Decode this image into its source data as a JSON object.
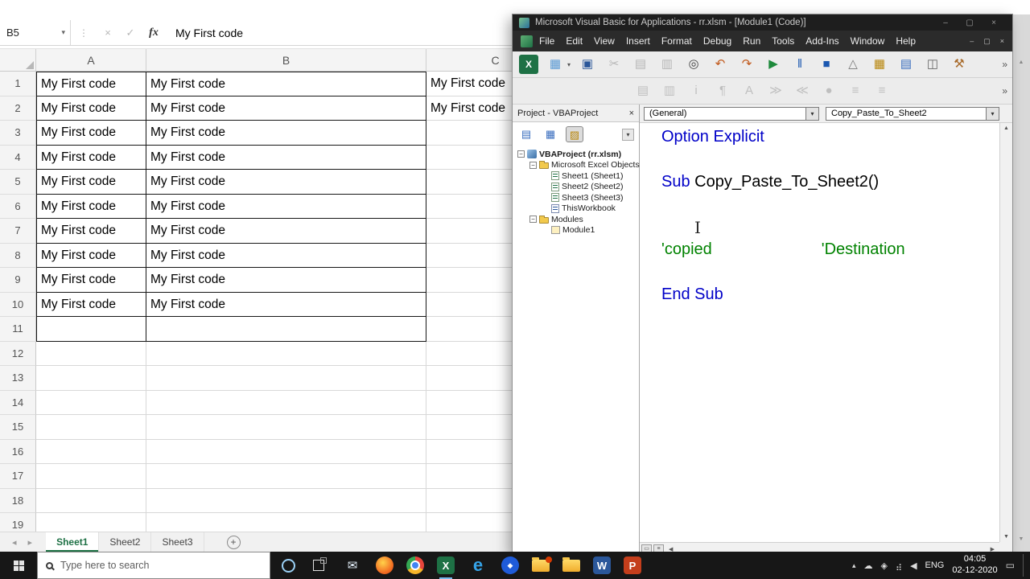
{
  "colors": {
    "excel_green": "#1e7145",
    "keyword_blue": "#0000C8",
    "comment_green": "#008200",
    "taskbar_dark": "#171717"
  },
  "excel": {
    "name_box": "B5",
    "formula_bar_value": "My First code",
    "fx_label": "fx",
    "cancel_glyph": "×",
    "enter_glyph": "✓",
    "columns": [
      "A",
      "B",
      "C"
    ],
    "row_labels": [
      "1",
      "2",
      "3",
      "4",
      "5",
      "6",
      "7",
      "8",
      "9",
      "10",
      "11",
      "12",
      "13",
      "14",
      "15",
      "16",
      "17",
      "18",
      "19"
    ],
    "cell_value": "My First code",
    "filled": {
      "a_b_rows": 10,
      "bordered_rows": 11,
      "c_rows": 2
    },
    "sheet_tabs": [
      {
        "label": "Sheet1",
        "active": true
      },
      {
        "label": "Sheet2",
        "active": false
      },
      {
        "label": "Sheet3",
        "active": false
      }
    ],
    "new_sheet_glyph": "+"
  },
  "vba": {
    "title": "Microsoft Visual Basic for Applications - rr.xlsm - [Module1 (Code)]",
    "window_controls": [
      "–",
      "▢",
      "×"
    ],
    "menus": [
      "File",
      "Edit",
      "View",
      "Insert",
      "Format",
      "Debug",
      "Run",
      "Tools",
      "Add-Ins",
      "Window",
      "Help"
    ],
    "toolbar_main": [
      {
        "name": "view-excel-icon",
        "glyph": "X",
        "bg": "#1e7145"
      },
      {
        "name": "insert-userform-icon",
        "glyph": "▦",
        "color": "#5b9bd5",
        "caret": true
      },
      {
        "name": "save-icon",
        "glyph": "▣",
        "color": "#2b579a"
      },
      {
        "name": "cut-icon",
        "glyph": "✂",
        "color": "#777",
        "dim": true
      },
      {
        "name": "copy-icon",
        "glyph": "▤",
        "color": "#777",
        "dim": true
      },
      {
        "name": "paste-icon",
        "glyph": "▥",
        "color": "#777",
        "dim": true
      },
      {
        "name": "find-icon",
        "glyph": "◎",
        "color": "#444"
      },
      {
        "name": "undo-icon",
        "glyph": "↶",
        "color": "#c25b1e"
      },
      {
        "name": "redo-icon",
        "glyph": "↷",
        "color": "#c25b1e"
      },
      {
        "name": "run-icon",
        "glyph": "▶",
        "color": "#1e8a3c"
      },
      {
        "name": "break-icon",
        "glyph": "‖",
        "color": "#1a57b0"
      },
      {
        "name": "reset-icon",
        "glyph": "■",
        "color": "#1a57b0"
      },
      {
        "name": "design-mode-icon",
        "glyph": "△",
        "color": "#777"
      },
      {
        "name": "project-explorer-icon",
        "glyph": "▦",
        "color": "#b8860b"
      },
      {
        "name": "properties-window-icon",
        "glyph": "▤",
        "color": "#3a6ebf"
      },
      {
        "name": "object-browser-icon",
        "glyph": "◫",
        "color": "#666"
      },
      {
        "name": "toolbox-icon",
        "glyph": "⚒",
        "color": "#a86a2a"
      }
    ],
    "toolbar_overflow_glyph": "»",
    "toolbar_edit": [
      {
        "name": "list-properties-icon",
        "glyph": "▤",
        "dim": true
      },
      {
        "name": "list-constants-icon",
        "glyph": "▥",
        "dim": true
      },
      {
        "name": "quick-info-icon",
        "glyph": "i",
        "dim": true
      },
      {
        "name": "parameter-info-icon",
        "glyph": "¶",
        "dim": true
      },
      {
        "name": "complete-word-icon",
        "glyph": "A",
        "dim": true
      },
      {
        "name": "indent-icon",
        "glyph": "≫",
        "dim": true
      },
      {
        "name": "outdent-icon",
        "glyph": "≪",
        "dim": true
      },
      {
        "name": "toggle-breakpoint-icon",
        "glyph": "●",
        "dim": true
      },
      {
        "name": "comment-block-icon",
        "glyph": "≡",
        "dim": true
      },
      {
        "name": "uncomment-block-icon",
        "glyph": "≡",
        "dim": true
      }
    ],
    "project": {
      "header": "Project - VBAProject",
      "close_glyph": "×",
      "toolbar": [
        {
          "name": "view-code-icon",
          "glyph": "▤",
          "color": "#3a6ebf"
        },
        {
          "name": "view-object-icon",
          "glyph": "▦",
          "color": "#3a6ebf"
        },
        {
          "name": "toggle-folders-icon",
          "glyph": "▨",
          "color": "#b8860b",
          "pressed": true
        }
      ],
      "toolbar_caret": "▾",
      "tree": [
        {
          "label": "VBAProject (rr.xlsm)",
          "level": 0,
          "icon": "project",
          "exp": true,
          "bold": true
        },
        {
          "label": "Microsoft Excel Objects",
          "level": 1,
          "icon": "folder",
          "exp": true
        },
        {
          "label": "Sheet1 (Sheet1)",
          "level": 2,
          "icon": "sheet"
        },
        {
          "label": "Sheet2 (Sheet2)",
          "level": 2,
          "icon": "sheet"
        },
        {
          "label": "Sheet3 (Sheet3)",
          "level": 2,
          "icon": "sheet"
        },
        {
          "label": "ThisWorkbook",
          "level": 2,
          "icon": "workbook"
        },
        {
          "label": "Modules",
          "level": 1,
          "icon": "folder",
          "exp": true
        },
        {
          "label": "Module1",
          "level": 2,
          "icon": "module"
        }
      ]
    },
    "code": {
      "object_dropdown": "(General)",
      "procedure_dropdown": "Copy_Paste_To_Sheet2",
      "lines": [
        {
          "segments": [
            {
              "t": "Option Explicit",
              "c": "kw"
            }
          ]
        },
        {
          "segments": []
        },
        {
          "segments": [
            {
              "t": "Sub ",
              "c": "kw"
            },
            {
              "t": "Copy_Paste_To_Sheet2()",
              "c": "plain"
            }
          ]
        },
        {
          "segments": []
        },
        {
          "segments": []
        },
        {
          "segments": [
            {
              "t": "'copied",
              "c": "comment"
            },
            {
              "t": "'Destination",
              "c": "comment",
              "gap": 136
            }
          ]
        },
        {
          "segments": []
        },
        {
          "segments": [
            {
              "t": "End Sub",
              "c": "kw"
            }
          ]
        }
      ]
    }
  },
  "taskbar": {
    "search_placeholder": "Type here to search",
    "apps": [
      {
        "name": "mail-icon",
        "cls": "mail",
        "glyph": "✉"
      },
      {
        "name": "firefox-icon",
        "cls": "ff"
      },
      {
        "name": "chrome-icon",
        "cls": "chrome"
      },
      {
        "name": "excel-icon",
        "cls": "excel",
        "glyph": "X",
        "active": true
      },
      {
        "name": "edge-icon",
        "cls": "edge",
        "glyph": "e"
      },
      {
        "name": "app-icon",
        "cls": "blueapp",
        "glyph": "◆"
      },
      {
        "name": "folder-badge-icon",
        "cls": "folder badged"
      },
      {
        "name": "file-explorer-icon",
        "cls": "folder"
      },
      {
        "name": "word-icon",
        "cls": "word",
        "glyph": "W"
      },
      {
        "name": "powerpoint-icon",
        "cls": "ppt",
        "glyph": "P"
      }
    ],
    "tray": {
      "hidden_icons_glyph": "▴",
      "icons": [
        {
          "name": "onedrive-icon",
          "glyph": "☁"
        },
        {
          "name": "security-icon",
          "glyph": "◈"
        },
        {
          "name": "network-icon",
          "glyph": "⣴"
        },
        {
          "name": "volume-icon",
          "glyph": "◀"
        }
      ],
      "language": "ENG",
      "time": "04:05",
      "date": "02-12-2020",
      "action_center_glyph": "▭"
    }
  }
}
